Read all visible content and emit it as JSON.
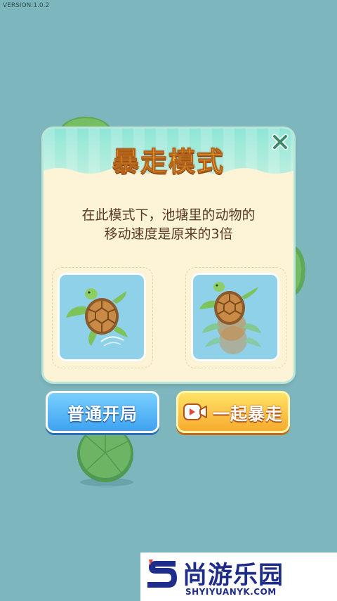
{
  "version": "VERSION:1.0.2",
  "dialog": {
    "title": "暴走模式",
    "desc_line1": "在此模式下，池塘里的动物的",
    "desc_line2": "移动速度是原来的3倍",
    "left_card_icon": "turtle-icon",
    "right_card_icon": "turtle-fast-icon",
    "close_icon": "close-icon"
  },
  "buttons": {
    "normal_label": "普通开局",
    "rage_label": "一起暴走",
    "rage_icon": "video-icon"
  },
  "watermark": {
    "brand": "尚游乐园",
    "url": "SHYIYUANYK.COM"
  },
  "colors": {
    "water": "#7eb6bd",
    "dialog_bg": "#fdf3d7",
    "title": "#f4b532",
    "blue_button": "#3c9ff0",
    "orange_button": "#f7a829"
  }
}
